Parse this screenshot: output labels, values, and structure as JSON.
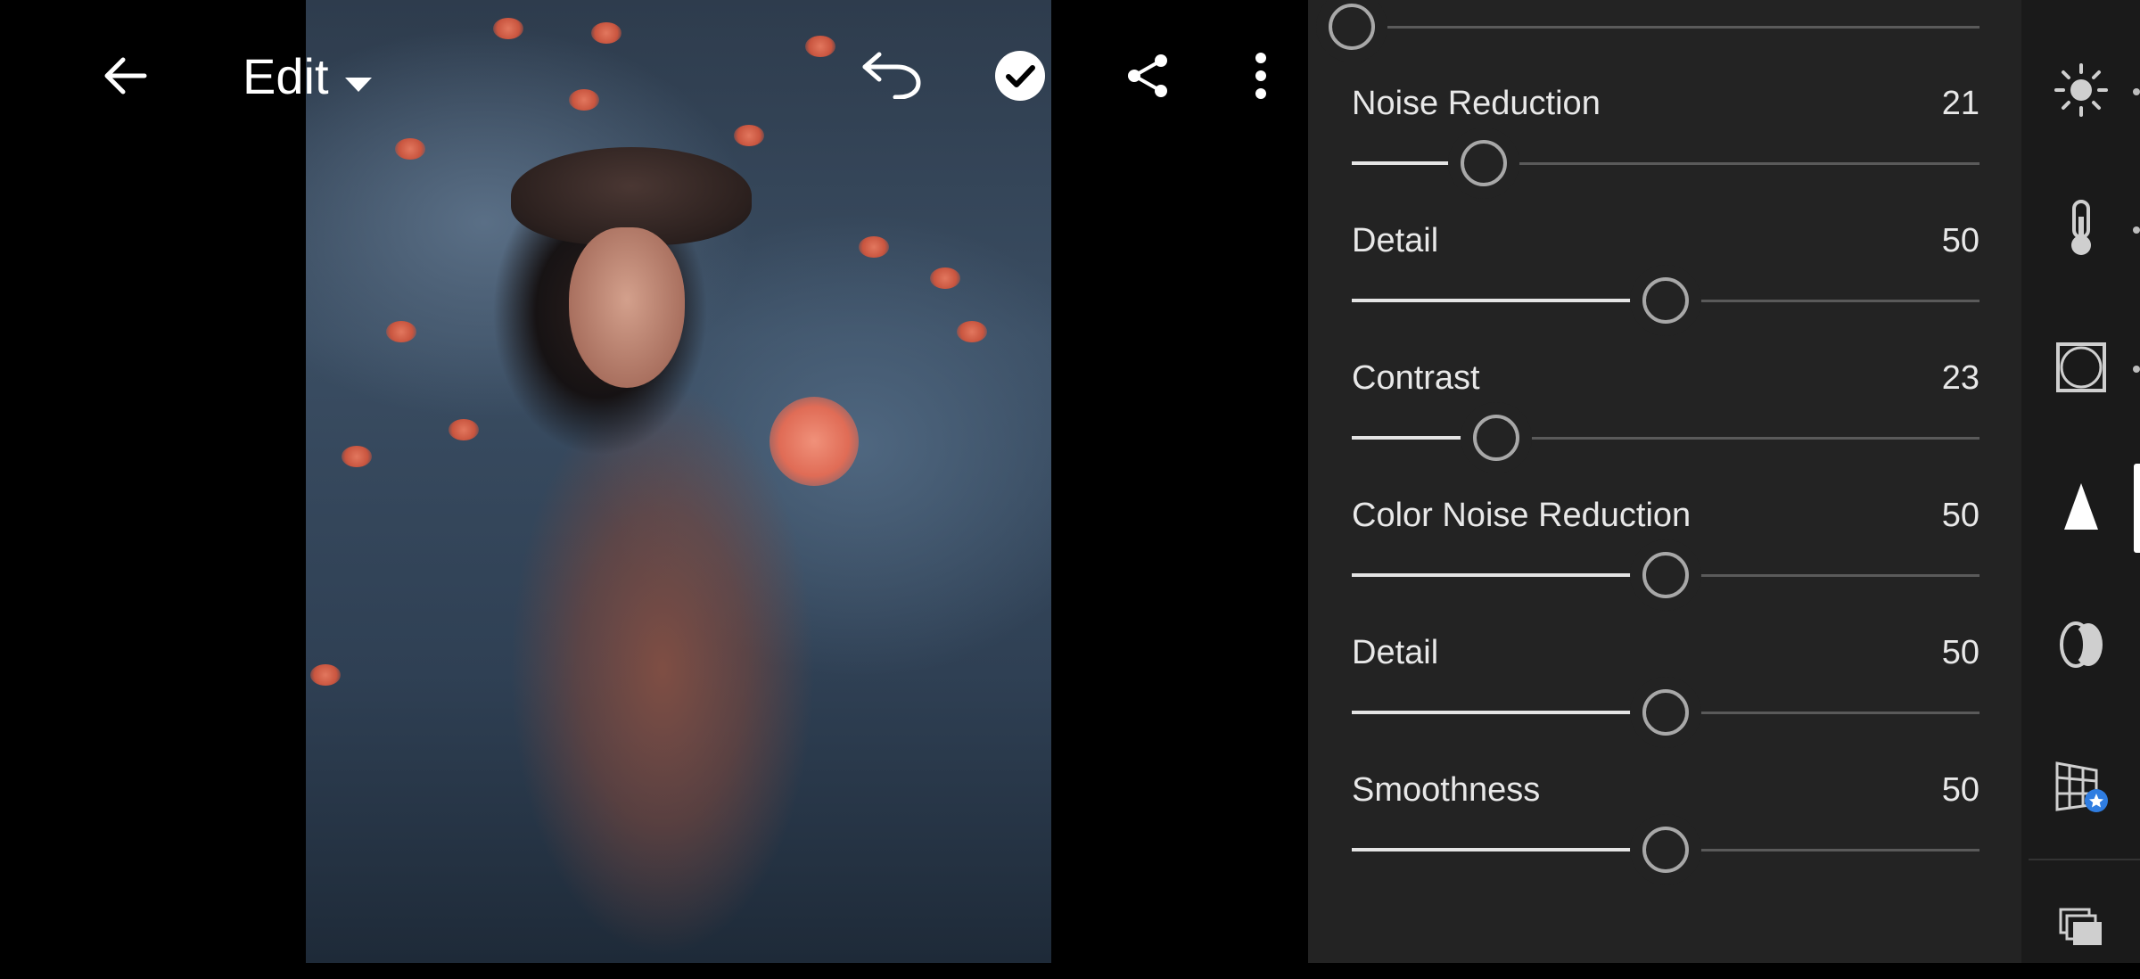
{
  "header": {
    "mode_label": "Edit"
  },
  "icons": {
    "back": "arrow-left-icon",
    "mode_dropdown": "caret-down-icon",
    "undo": "undo-icon",
    "confirm": "check-circle-icon",
    "share": "share-icon",
    "more": "more-vertical-icon"
  },
  "panel": {
    "sliders": [
      {
        "label": "",
        "value": "",
        "min": -100,
        "max": 100,
        "current": -100,
        "partial": true
      },
      {
        "label": "Noise Reduction",
        "value": "21",
        "min": 0,
        "max": 100,
        "current": 21
      },
      {
        "label": "Detail",
        "value": "50",
        "min": 0,
        "max": 100,
        "current": 50
      },
      {
        "label": "Contrast",
        "value": "23",
        "min": 0,
        "max": 100,
        "current": 23
      },
      {
        "label": "Color Noise Reduction",
        "value": "50",
        "min": 0,
        "max": 100,
        "current": 50
      },
      {
        "label": "Detail",
        "value": "50",
        "min": 0,
        "max": 100,
        "current": 50
      },
      {
        "label": "Smoothness",
        "value": "50",
        "min": 0,
        "max": 100,
        "current": 50
      }
    ]
  },
  "toolstrip": {
    "tools": [
      {
        "icon": "light-sun-icon",
        "active": false
      },
      {
        "icon": "color-thermometer-icon",
        "active": false
      },
      {
        "icon": "effects-vignette-icon",
        "active": false
      },
      {
        "icon": "detail-triangle-icon",
        "active": true
      },
      {
        "icon": "optics-lens-icon",
        "active": false
      },
      {
        "icon": "geometry-grid-icon",
        "active": false
      },
      {
        "icon": "versions-stack-icon",
        "active": false
      }
    ]
  },
  "colors": {
    "panel_bg": "#232323",
    "strip_bg": "#1a1a1a",
    "slider_fill": "#e4e4e4",
    "slider_track": "#5a5a5a",
    "premium_badge": "#2f7de1"
  }
}
